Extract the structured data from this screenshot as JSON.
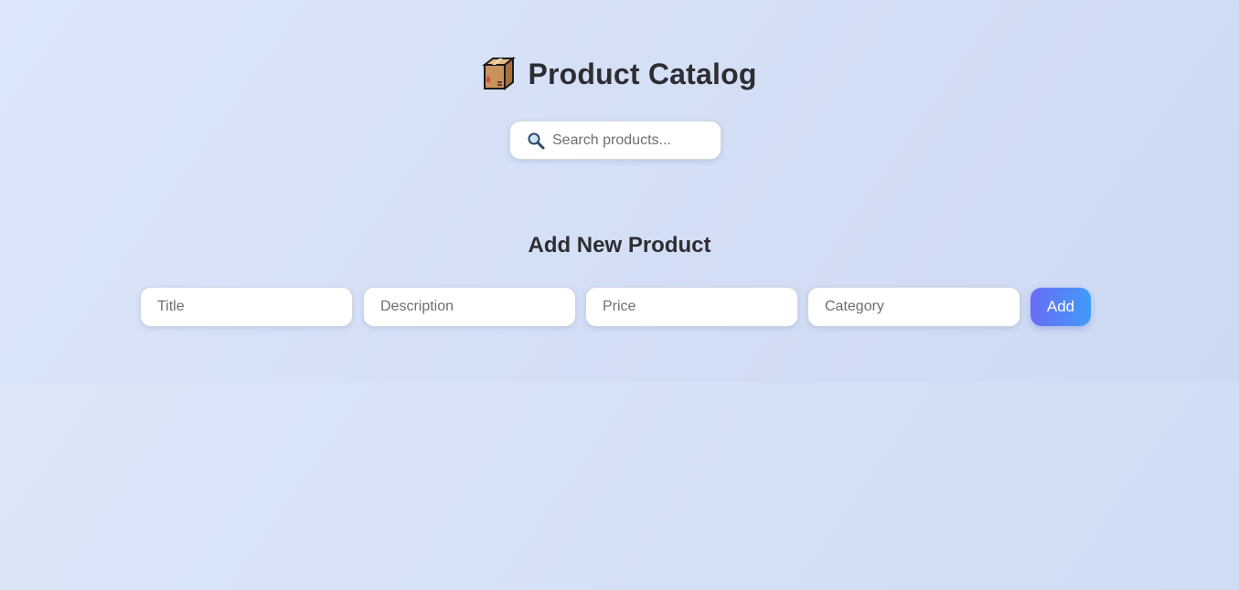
{
  "header": {
    "icon": "package-box-icon",
    "title": "Product Catalog"
  },
  "search": {
    "icon": "search-icon",
    "placeholder": "Search products..."
  },
  "add_form": {
    "heading": "Add New Product",
    "fields": {
      "title_placeholder": "Title",
      "description_placeholder": "Description",
      "price_placeholder": "Price",
      "category_placeholder": "Category"
    },
    "submit_label": "Add"
  },
  "colors": {
    "background": "#dbe6fa",
    "title_text": "#2e2e32",
    "button_gradient_start": "#6a6cf6",
    "button_gradient_end": "#3f9cf7"
  }
}
